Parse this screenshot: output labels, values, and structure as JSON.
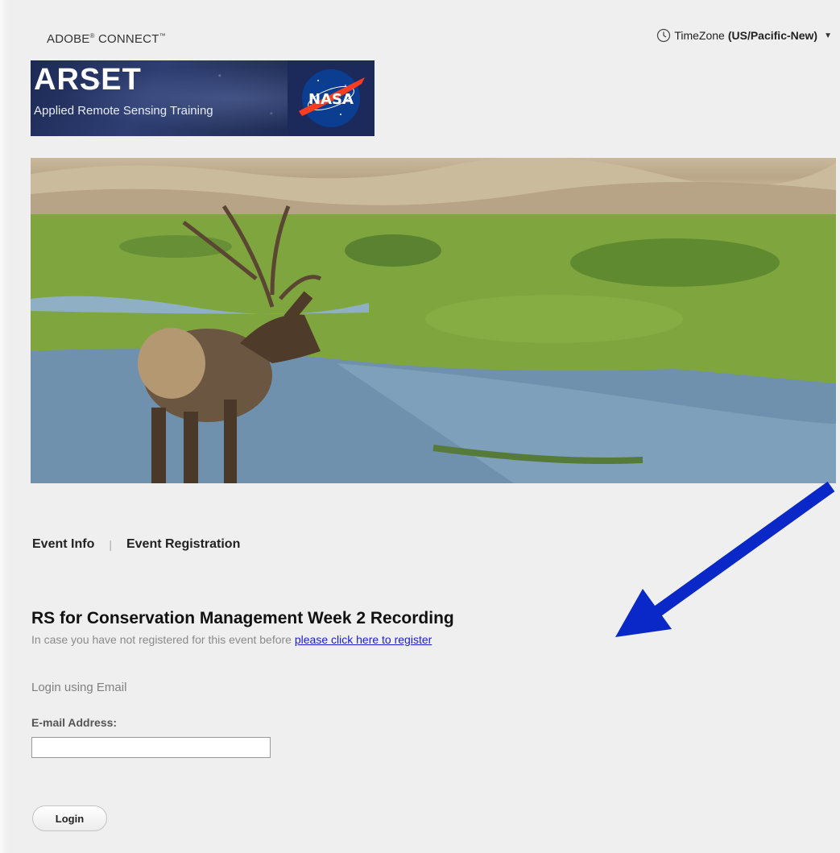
{
  "header": {
    "brand_name": "ADOBE",
    "brand_product": "CONNECT",
    "brand_reg": "®",
    "brand_tm": "™",
    "timezone_label": "TimeZone",
    "timezone_value": "(US/Pacific-New)",
    "timezone_icon": "clock-icon",
    "timezone_caret": "▼"
  },
  "banner": {
    "title": "ARSET",
    "subtitle": "Applied Remote Sensing Training",
    "logo_text": "NASA",
    "colors": {
      "background": "#1c2a55",
      "nasa_blue": "#0b3d91",
      "nasa_red": "#fc3d21"
    }
  },
  "hero": {
    "description_icon": "elk-landscape-image"
  },
  "tabs": [
    {
      "label": "Event Info"
    },
    {
      "label": "Event Registration"
    }
  ],
  "tabs_separator": "|",
  "event": {
    "title": "RS for Conservation Management Week 2 Recording",
    "subtitle": "In case you have not registered for this event before",
    "register_link": "please click here to register"
  },
  "login": {
    "method": "Login using Email",
    "email_label": "E-mail Address:",
    "email_value": "",
    "button_label": "Login"
  },
  "annotation": {
    "arrow_color": "#0a27c8",
    "arrow_icon": "arrow-icon"
  }
}
